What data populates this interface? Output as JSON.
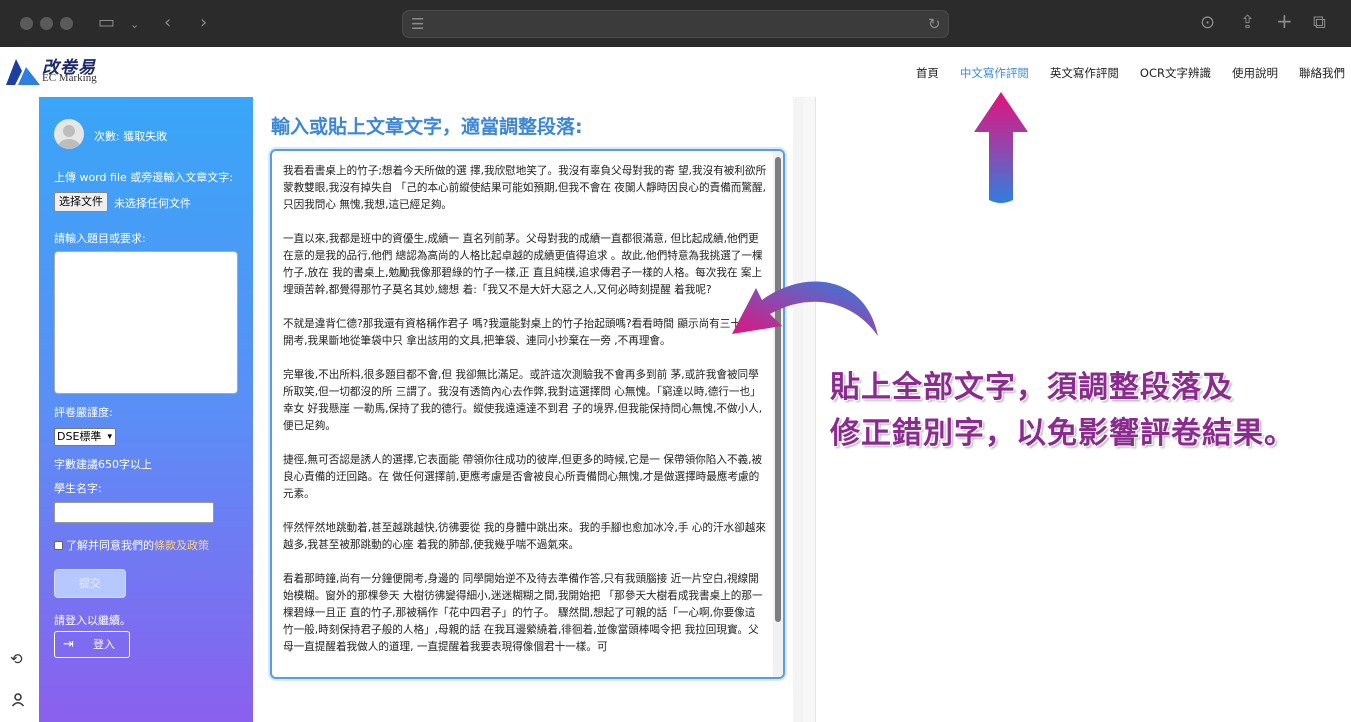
{
  "browser": {
    "icons": [
      "sidebar-icon",
      "chevron-down-icon",
      "back-icon",
      "forward-icon",
      "reader-icon",
      "reload-icon",
      "download-icon",
      "share-icon",
      "new-tab-icon",
      "tabs-icon"
    ]
  },
  "header": {
    "logo_text": "改卷易",
    "logo_sub": "EC Marking",
    "nav": [
      {
        "label": "首頁",
        "active": false
      },
      {
        "label": "中文寫作評閱",
        "active": true
      },
      {
        "label": "英文寫作評閱",
        "active": false
      },
      {
        "label": "OCR文字辨識",
        "active": false
      },
      {
        "label": "使用說明",
        "active": false
      },
      {
        "label": "聯絡我們",
        "active": false
      }
    ]
  },
  "sidebar": {
    "count_text": "次數: 獲取失敗",
    "upload_label": "上傳 word file 或旁邊輸入文章文字:",
    "file_button": "选择文件",
    "file_none": "未选择任何文件",
    "topic_label": "請輸入題目或要求:",
    "strictness_label": "評卷嚴謹度:",
    "strictness_value": "DSE標準",
    "word_hint": "字數建議650字以上",
    "student_label": "學生名字:",
    "agree_text": "了解并同意我們的",
    "agree_link": "條款及政策",
    "submit": "提交",
    "login_hint": "請登入以繼續。",
    "login_button": "登入"
  },
  "main": {
    "heading": "輸入或貼上文章文字，適當調整段落:",
    "essay_paragraphs": [
      "我看看書桌上的竹子;想着今天所做的選 擇,我欣慰地笑了。我沒有辜負父母對我的寄 望,我沒有被利欲所蒙教雙眼,我沒有掉失自 「己的本心前縱使結果可能如預期,但我不會在 夜闌人靜時因良心的責備而驚醒,只因我問心 無愧,我想,這已經足夠。",
      "一直以來,我都是班中的資優生,成績一 直名列前茅。父母對我的成績一直都很滿意, 但比起成績,他們更在意的是我的品行,他們 總認為高尚的人格比起卓越的成績更值得追求 。故此,他們特意為我挑選了一棵竹子,放在 我的書桌上,勉勵我像那碧綠的竹子一樣,正 直且純樸,追求傳君子一樣的人格。每次我在 案上埋頭苦幹,都覺得那竹子莫名其妙,總想 着:「我又不是大奸大惡之人,又何必時刻提醒 着我呢?",
      "不就是違背仁德?那我還有資格稱作君子 嗎?我還能對桌上的竹子抬起頭嗎?看看時間 顯示尚有三十秒才開考,我果斷地從筆袋中只 拿出該用的文具,把筆袋、連同小抄棄在一旁 ,不再理會。",
      "完畢後,不出所料,很多題目都不會,但 我卻無比滿足。或許這次測驗我不會再多到前 茅,或許我會被同學所取笑,但一切都沒的所 三謂了。我沒有透筒內心去作弊,我對這選擇問 心無愧。「窮達以時,德行一也」幸女 好我懸崖 一勒馬,保持了我的德行。縱使我遠遠達不到君 子的境界,但我能保持問心無愧,不做小人, 便已足夠。",
      "捷徑,無可否認是誘人的選擇,它表面能 帶領你往成功的彼岸,但更多的時候,它是一 保帶領你陷入不義,被良心責備的迂回路。在 做任何選擇前,更應考慮是否會被良心所責備問心無愧,才是做選擇時最應考慮的元素。",
      "怦然怦然地跳動着,甚至越跳越快,彷彿要從 我的身體中跳出來。我的手腳也愈加冰冷,手 心的汗水卻越來越多,我甚至被那跳動的心座 着我的肺部,使我幾乎喘不過氣來。",
      "看着那時鐘,尚有一分鐘便開考,身邊的 同學開始逆不及待去準備作答,只有我頭腦接 近一片空白,視線開始模糊。窗外的那棵參天 大樹彷彿變得細小,迷迷糊糊之間,我開始把 「那參天大樹看成我書桌上的那一棵碧綠一且正 直的竹子,那被稱作「花中四君子」的竹子。 驟然間,想起了可親的話「一心啊,你要像這 竹一般,時刻保持君子般的人格」,母親的話 在我耳邊縈繞着,徘徊着,並像當頭棒喝令把 我拉回現實。父母一直提醒着我做人的道理, 一直提醒着我要表現得像個君十一樣。可"
    ]
  },
  "annotation": {
    "line1": "貼上全部文字，須調整段落及",
    "line2": "修正錯別字，以免影響評卷結果。"
  },
  "colors": {
    "accent": "#3d87d9",
    "annotation": "#8b2a8f",
    "arrow_top": "#e0137e",
    "arrow_bottom": "#2f7fe0"
  }
}
